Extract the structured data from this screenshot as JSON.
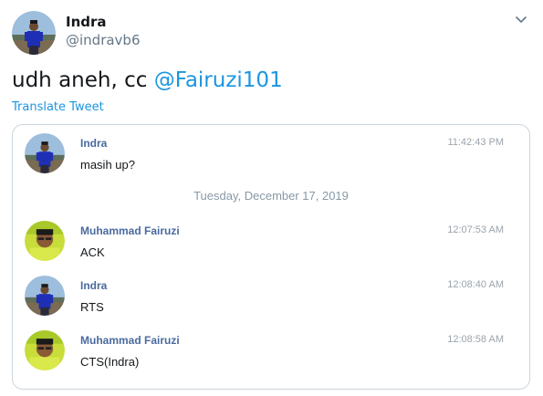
{
  "tweet": {
    "author_name": "Indra",
    "author_handle": "@indravb6",
    "text_prefix": "udh aneh, cc ",
    "mention": "@Fairuzi101",
    "translate_link": "Translate Tweet",
    "menu_icon": "chevron-down-icon"
  },
  "chat": {
    "date_separator": "Tuesday, December 17, 2019",
    "messages": [
      {
        "sender": "Indra",
        "time": "11:42:43 PM",
        "text": "masih up?"
      },
      {
        "sender": "Muhammad Fairuzi",
        "time": "12:07:53 AM",
        "text": "ACK"
      },
      {
        "sender": "Indra",
        "time": "12:08:40 AM",
        "text": "RTS"
      },
      {
        "sender": "Muhammad Fairuzi",
        "time": "12:08:58 AM",
        "text": "CTS(Indra)"
      }
    ]
  },
  "colors": {
    "link": "#1b95e0",
    "sender": "#4a6a9e",
    "muted": "#657786",
    "border": "#ccd6dd"
  }
}
